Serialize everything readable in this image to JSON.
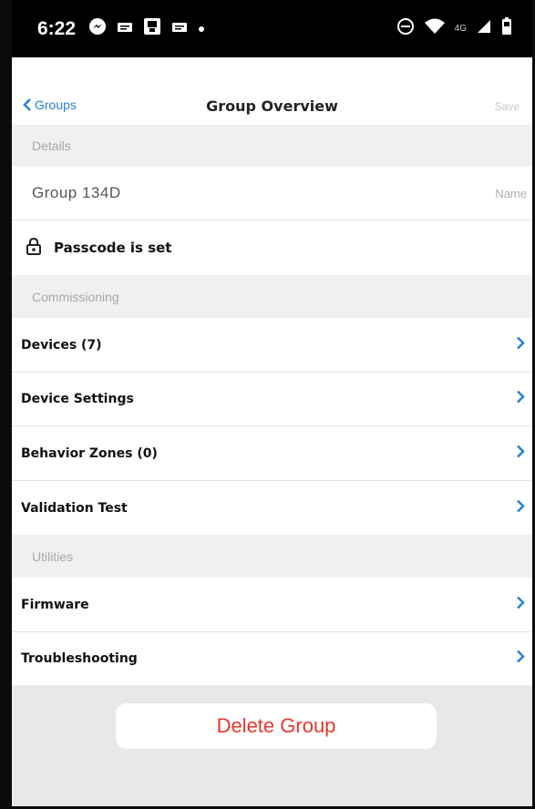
{
  "status_bar": {
    "time": "6:22",
    "left_icons": [
      "messenger-icon",
      "notification-icon",
      "image-icon",
      "notification-icon",
      "dot-icon"
    ],
    "right_icons": [
      "dnd-icon",
      "wifi-icon",
      "lte-icon",
      "signal-icon",
      "battery-icon"
    ],
    "network_label": "4G"
  },
  "nav": {
    "back_label": "Groups",
    "title": "Group Overview",
    "save_label": "Save"
  },
  "sections": {
    "details": "Details",
    "commissioning": "Commissioning",
    "utilities": "Utilities"
  },
  "details": {
    "group_name": "Group 134D",
    "name_hint": "Name",
    "passcode_label": "Passcode is set"
  },
  "commissioning_items": [
    {
      "label": "Devices (7)"
    },
    {
      "label": "Device Settings"
    },
    {
      "label": "Behavior Zones (0)"
    },
    {
      "label": "Validation Test"
    }
  ],
  "utilities_items": [
    {
      "label": "Firmware"
    },
    {
      "label": "Troubleshooting"
    }
  ],
  "delete_button": "Delete Group",
  "colors": {
    "accent": "#2a7fd4",
    "danger": "#e5382f",
    "section_bg": "#f0f0f0"
  }
}
